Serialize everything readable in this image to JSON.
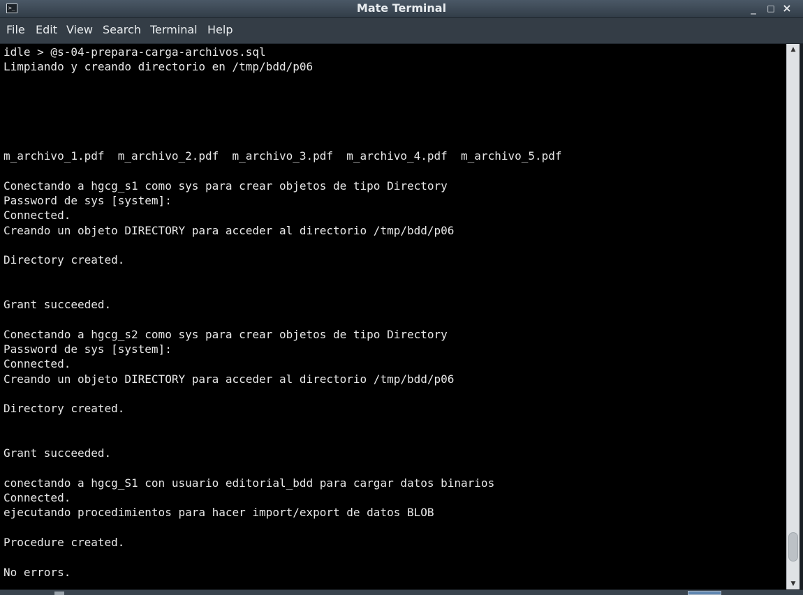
{
  "window": {
    "title": "Mate Terminal",
    "icon": "terminal-icon",
    "icon_glyph": ">_",
    "controls": {
      "minimize_glyph": "_",
      "maximize_glyph": "□",
      "close_glyph": "×"
    }
  },
  "menu": {
    "items": [
      "File",
      "Edit",
      "View",
      "Search",
      "Terminal",
      "Help"
    ]
  },
  "terminal": {
    "lines": [
      "idle > @s-04-prepara-carga-archivos.sql",
      "Limpiando y creando directorio en /tmp/bdd/p06",
      "",
      "",
      "",
      "",
      "",
      "m_archivo_1.pdf  m_archivo_2.pdf  m_archivo_3.pdf  m_archivo_4.pdf  m_archivo_5.pdf",
      "",
      "Conectando a hgcg_s1 como sys para crear objetos de tipo Directory",
      "Password de sys [system]:",
      "Connected.",
      "Creando un objeto DIRECTORY para acceder al directorio /tmp/bdd/p06",
      "",
      "Directory created.",
      "",
      "",
      "Grant succeeded.",
      "",
      "Conectando a hgcg_s2 como sys para crear objetos de tipo Directory",
      "Password de sys [system]:",
      "Connected.",
      "Creando un objeto DIRECTORY para acceder al directorio /tmp/bdd/p06",
      "",
      "Directory created.",
      "",
      "",
      "Grant succeeded.",
      "",
      "conectando a hgcg_S1 con usuario editorial_bdd para cargar datos binarios",
      "Connected.",
      "ejecutando procedimientos para hacer import/export de datos BLOB",
      "",
      "Procedure created.",
      "",
      "No errors."
    ]
  },
  "colors": {
    "terminal_bg": "#000000",
    "terminal_fg": "#e8e8e8",
    "titlebar": "#3d4955",
    "menubar": "#343d46"
  }
}
